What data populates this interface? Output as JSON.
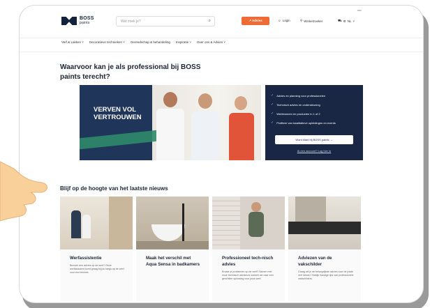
{
  "header": {
    "logo_text_1": "BOSS",
    "logo_text_2": "paints",
    "search_placeholder": "Wat zoek je?",
    "cta_label": "↗ Advies",
    "login_label": "Login",
    "store_label": "Winkelzoeker",
    "cart_label": "NL",
    "lang_label": "••••"
  },
  "nav": {
    "items": [
      "Verf & Lakken",
      "Decoratieve technieken",
      "Gereedschap & behandeling",
      "Inspiratie",
      "Over ons & Advies"
    ]
  },
  "main": {
    "headline": "Waarvoor kan je als professional bij BOSS paints terecht?",
    "hero_text": "VERVEN VOL VERTROUWEN",
    "panel": {
      "bullets": [
        "Advies en planning voor professionelen",
        "Technisch advies en ondersteuning",
        "Werkbonnen en producten in 1 of 2",
        "Profiteer van kwalitatieve opleidingen en events"
      ],
      "button_label": "Word klant bij BOSS paints →",
      "link_label": "Al een account? Log hier in"
    },
    "news_title": "Blijf op de hoogte van het laatste nieuws",
    "cards": [
      {
        "title": "Werfassistentie",
        "desc": "Bezoek een advies op de werf? Onze werfassistent komt graag bij jou langs op de werf voor een bezoek."
      },
      {
        "title": "Maak het verschil met Aqua Sensa in badkamers",
        "desc": ""
      },
      {
        "title": "Professioneel tech-nisch advies",
        "desc": "Ervaar je problemen op de werf? Samen met onze technisch adviseurs zoeken we naar een geschikte oplossing voor jouw werf."
      },
      {
        "title": "Adviezen van de vakschilder",
        "desc": "Graag wil je de belangrijkste advies voor de juiste verf kiezen? Bekijk handige tips van professionele vakschilders."
      }
    ]
  },
  "colors": {
    "brand_navy": "#14233d",
    "accent_orange": "#f06a33",
    "panel_navy": "#1a2744",
    "stripe_green": "#2f8a6a"
  }
}
